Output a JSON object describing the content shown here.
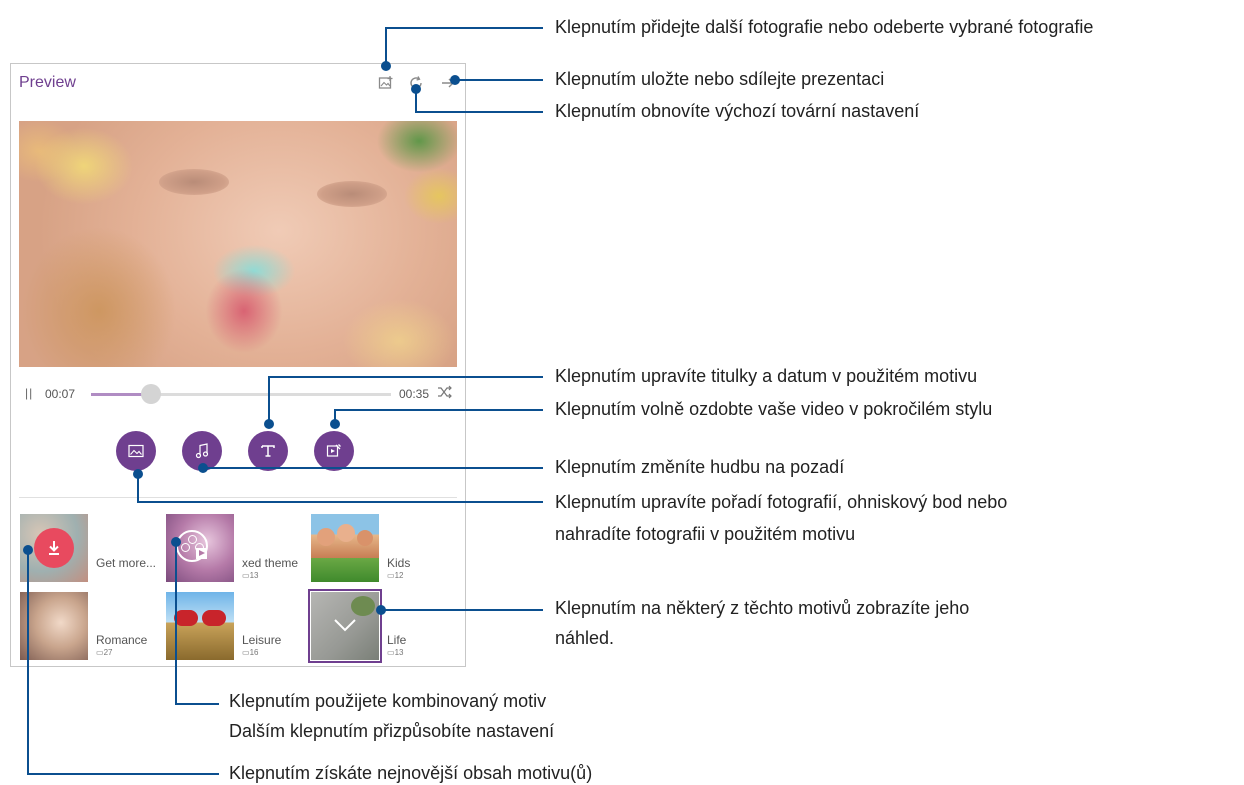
{
  "panel": {
    "title": "Preview",
    "toolbar": {
      "add_photos_icon": "add-photos-icon",
      "reset_icon": "reset-icon",
      "share_icon": "arrow-right-icon"
    }
  },
  "player": {
    "pause_icon": "||",
    "current_time": "00:07",
    "total_time": "00:35",
    "progress": 0.2,
    "shuffle_icon": "shuffle-icon"
  },
  "tools": [
    "photo-edit-icon",
    "music-icon",
    "text-icon",
    "advanced-edit-icon"
  ],
  "themes": [
    {
      "label": "Get more...",
      "count": ""
    },
    {
      "label": "xed theme",
      "count": "13"
    },
    {
      "label": "Kids",
      "count": "12"
    },
    {
      "label": "Romance",
      "count": "27"
    },
    {
      "label": "Leisure",
      "count": "16"
    },
    {
      "label": "Life",
      "count": "13"
    }
  ],
  "callouts": {
    "add_photos": "Klepnutím přidejte další fotografie nebo odeberte vybrané fotografie",
    "save_share": "Klepnutím uložte nebo sdílejte prezentaci",
    "reset": "Klepnutím obnovíte výchozí tovární nastavení",
    "titles": "Klepnutím upravíte titulky a datum v použitém motivu",
    "decorate": "Klepnutím volně ozdobte vaše video v pokročilém stylu",
    "music": "Klepnutím změníte hudbu na pozadí",
    "photos_line1": "Klepnutím upravíte pořadí fotografií, ohniskový bod nebo",
    "photos_line2": "nahradíte fotografii v použitém motivu",
    "preview_line1": "Klepnutím na některý z těchto motivů zobrazíte jeho",
    "preview_line2": "náhled.",
    "mixed_line1": "Klepnutím použijete kombinovaný motiv",
    "mixed_line2": "Dalším klepnutím přizpůsobíte nastavení",
    "get_more": "Klepnutím získáte nejnovější obsah motivu(ů)"
  },
  "colors": {
    "accent": "#6f3f8f",
    "callout_line": "#0b4f8f",
    "download": "#e84a5f"
  }
}
